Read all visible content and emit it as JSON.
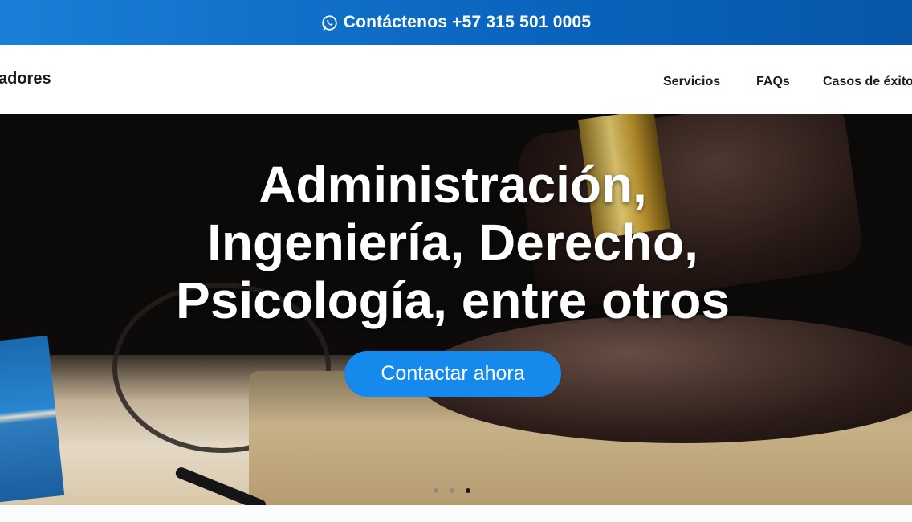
{
  "topbar": {
    "icon": "whatsapp-icon",
    "contact_text": "Contáctenos +57 315 501 0005"
  },
  "header": {
    "brand_partial": "adores",
    "nav": [
      {
        "label": "Servicios"
      },
      {
        "label": "FAQs"
      },
      {
        "label": "Casos de éxito"
      }
    ]
  },
  "hero": {
    "title_lines": [
      "Administración,",
      "Ingeniería, Derecho,",
      "Psicología, entre otros"
    ],
    "cta_label": "Contactar ahora",
    "slides_total": 3,
    "slide_active": 3
  },
  "colors": {
    "topbar_blue": "#0a66bf",
    "cta_blue": "#1689ec",
    "text_dark": "#1c1c1c"
  }
}
